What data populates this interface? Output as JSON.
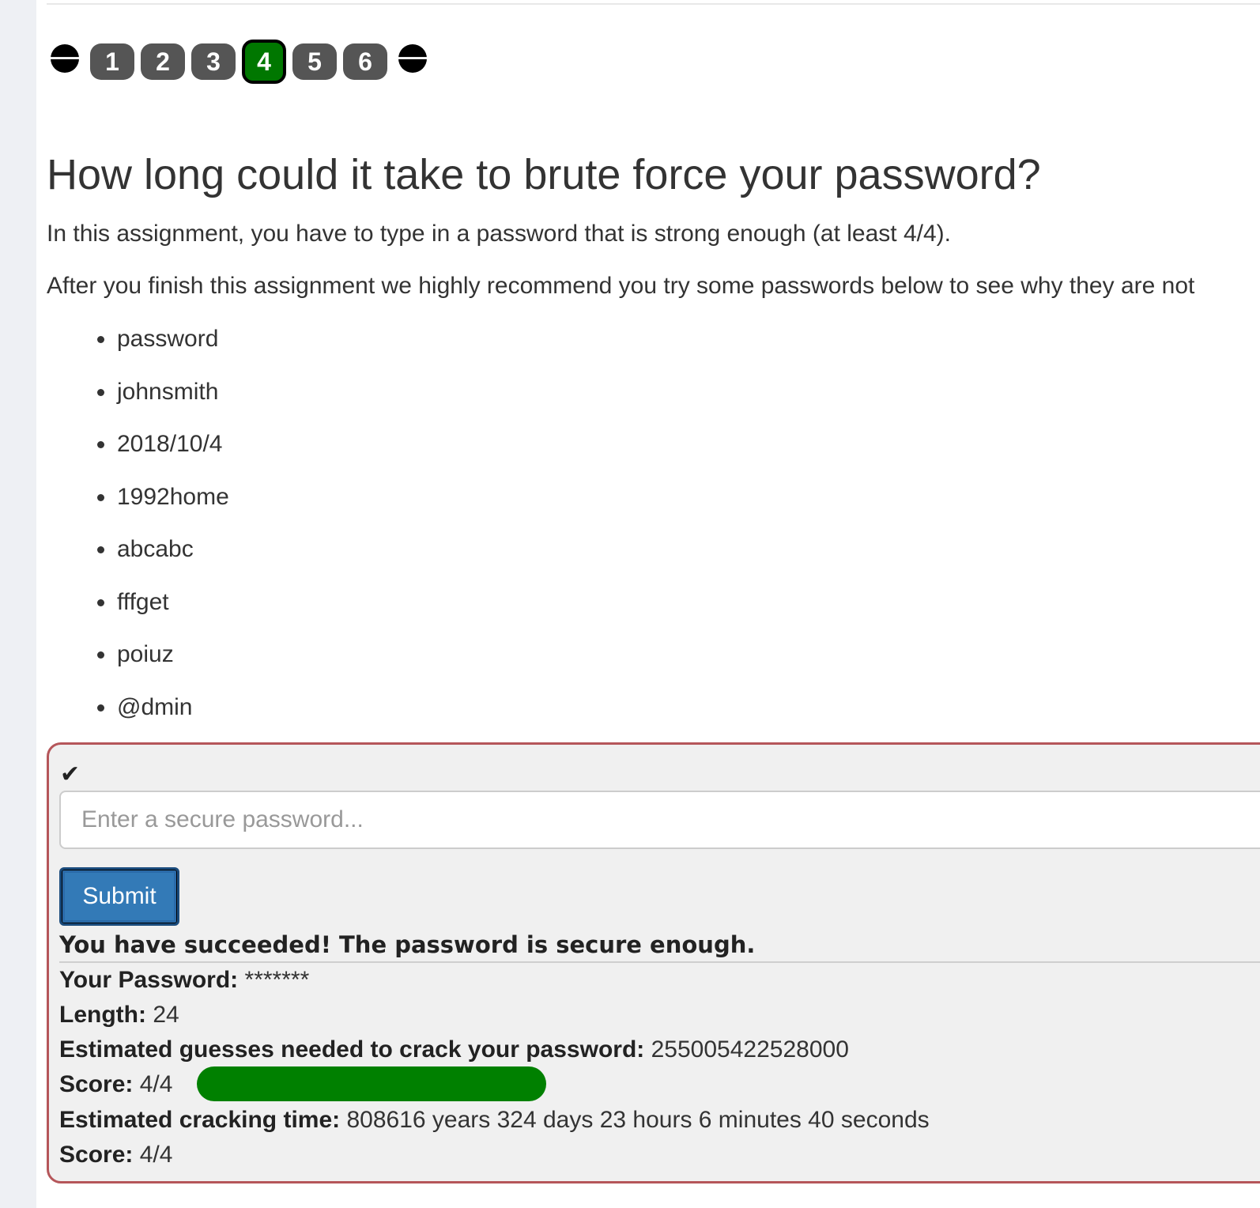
{
  "pagination": {
    "prev_icon": "arrow-left-icon",
    "next_icon": "arrow-right-icon",
    "prev_glyph": "🡐",
    "next_glyph": "🡒",
    "pages": [
      "1",
      "2",
      "3",
      "4",
      "5",
      "6"
    ],
    "active_page": "4",
    "active_color": "#007700"
  },
  "content": {
    "title": "How long could it take to brute force your password?",
    "intro": "In this assignment, you have to type in a password that is strong enough (at least 4/4).",
    "recommend": "After you finish this assignment we highly recommend you try some passwords below to see why they are not",
    "passwords": [
      "password",
      "johnsmith",
      "2018/10/4",
      "1992home",
      "abcabc",
      "fffget",
      "poiuz",
      "@dmin"
    ]
  },
  "form": {
    "status_icon": "check-icon",
    "status_glyph": "✔",
    "password_placeholder": "Enter a secure password...",
    "submit_label": "Submit",
    "border_color": "#b5565a"
  },
  "result": {
    "headline": "You have succeeded! The password is secure enough.",
    "password_label": "Your Password:",
    "password_value": "*******",
    "length_label": "Length:",
    "length_value": "24",
    "guesses_label": "Estimated guesses needed to crack your password:",
    "guesses_value": "255005422528000",
    "score_label": "Score:",
    "score_value": "4/4",
    "score_fraction": 1.0,
    "meter_color": "#008000",
    "time_label": "Estimated cracking time:",
    "time_value": "808616 years 324 days 23 hours 6 minutes 40 seconds",
    "score2_label": "Score:",
    "score2_value": "4/4"
  }
}
